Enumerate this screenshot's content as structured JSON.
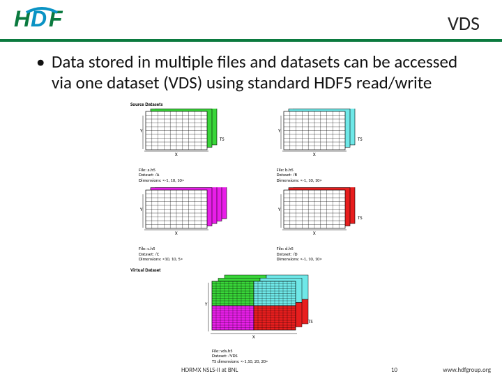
{
  "header": {
    "title": "VDS",
    "logo_text": "HDF"
  },
  "bullet_text": "Data stored in multiple files and datasets can be accessed via one dataset (VDS) using standard HDF5 read/write",
  "diagram": {
    "section_source": "Source Datasets",
    "section_virtual": "Virtual Dataset",
    "block_a": {
      "file": "File: a.h5",
      "dataset": "Dataset: /A",
      "dims": "Dimensions: <-1, 10, 10>"
    },
    "block_b": {
      "file": "File: b.h5",
      "dataset": "Dataset: /B",
      "dims": "Dimensions: <-1, 10, 10>"
    },
    "block_c": {
      "file": "File: c.h5",
      "dataset": "Dataset: /C",
      "dims": "Dimensions: <10, 10, 5>"
    },
    "block_d": {
      "file": "File: d.h5",
      "dataset": "Dataset: /D",
      "dims": "Dimensions: <-1, 10, 10>"
    },
    "block_vds": {
      "file": "File: vds.h5",
      "dataset": "Dataset: /VDS",
      "dims": "TS dimensions: <-1,10, 20, 20>"
    },
    "axes": {
      "x": "X",
      "y": "Y",
      "ts": "TS"
    }
  },
  "footer": {
    "center": "HDRMX NSLS-II at BNL",
    "page": "10",
    "url": "www.hdfgroup.org"
  },
  "colors": {
    "green": "#39d639",
    "cyan": "#6fe8e8",
    "magenta": "#e81ee8",
    "red": "#e81e1e",
    "accent": "#0b7a3f",
    "accent2": "#0a93c4"
  }
}
